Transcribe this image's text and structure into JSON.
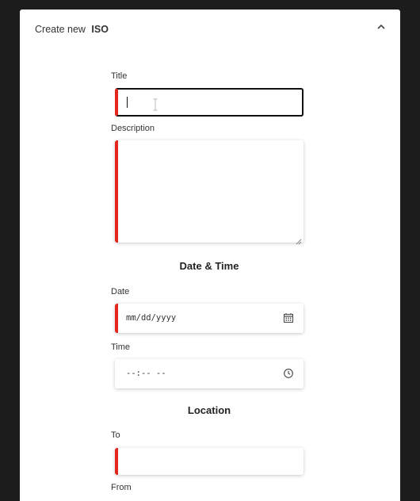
{
  "header": {
    "prefix": "Create new",
    "entity": "ISO",
    "collapse_icon": "chevron-up-icon"
  },
  "form": {
    "title": {
      "label": "Title",
      "value": "",
      "required": true,
      "focused": true
    },
    "description": {
      "label": "Description",
      "value": "",
      "required": true
    },
    "date_time_section": "Date & Time",
    "date": {
      "label": "Date",
      "placeholder": "mm/dd/yyyy",
      "required": true,
      "icon": "calendar-icon"
    },
    "time": {
      "label": "Time",
      "placeholder": "--:-- --",
      "required": false,
      "icon": "clock-icon"
    },
    "location_section": "Location",
    "to": {
      "label": "To",
      "value": "",
      "required": true
    },
    "from": {
      "label": "From"
    }
  },
  "colors": {
    "required_accent": "#e3261e",
    "page_background": "#1c1c1c",
    "card_background": "#ffffff"
  }
}
